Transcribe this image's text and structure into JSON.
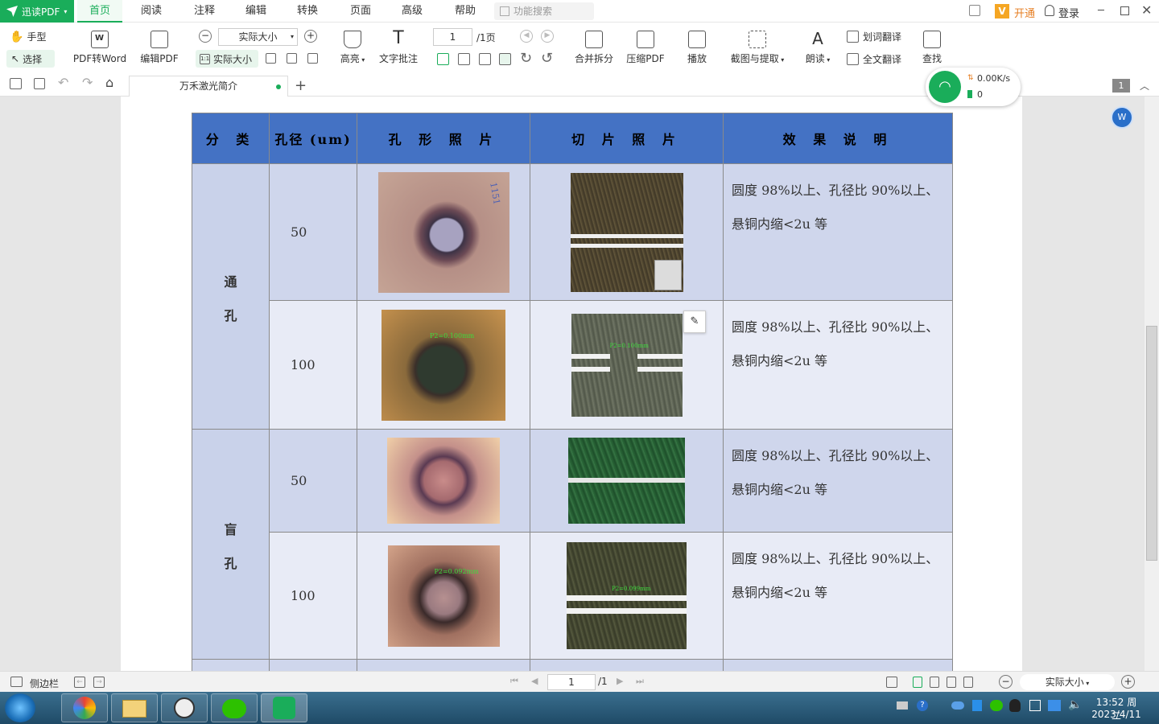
{
  "app": {
    "name": "迅读PDF"
  },
  "menu": {
    "items": [
      "首页",
      "阅读",
      "注释",
      "编辑",
      "转换",
      "页面",
      "高级",
      "帮助"
    ],
    "search_placeholder": "功能搜索",
    "open_vip": "开通",
    "login": "登录"
  },
  "toolbar": {
    "hand": "手型",
    "select": "选择",
    "pdf_to_word": "PDF转Word",
    "edit_pdf": "编辑PDF",
    "zoom_value": "实际大小",
    "actual_size": "实际大小",
    "page_input": "1",
    "page_total": "/1页",
    "highlight": "高亮",
    "text_comment": "文字批注",
    "merge_split": "合并拆分",
    "compress_pdf": "压缩PDF",
    "play": "播放",
    "screenshot": "截图与提取",
    "read_aloud": "朗读",
    "word_translate": "划词翻译",
    "full_translate": "全文翻译",
    "find": "查找"
  },
  "tabs": {
    "document": "万禾激光简介",
    "page_badge": "1"
  },
  "network": {
    "speed": "0.00K/s",
    "count": "0"
  },
  "table": {
    "headers": [
      "分 类",
      "孔径 (um)",
      "孔 形 照 片",
      "切 片 照 片",
      "效 果 说 明"
    ],
    "groups": [
      {
        "category": "通\n孔",
        "rows": [
          {
            "diameter": "50",
            "effect": "圆度 98%以上、孔径比 90%以上、悬铜内缩<2u 等",
            "overlay_hole": "1151",
            "overlay_slice": ""
          },
          {
            "diameter": "100",
            "effect": "圆度 98%以上、孔径比 90%以上、悬铜内缩<2u 等",
            "overlay_hole": "P2=0.100mm",
            "overlay_slice": "P2=0.100mm"
          }
        ]
      },
      {
        "category": "盲\n孔",
        "rows": [
          {
            "diameter": "50",
            "effect": "圆度 98%以上、孔径比 90%以上、悬铜内缩<2u 等",
            "overlay_hole": "",
            "overlay_slice": ""
          },
          {
            "diameter": "100",
            "effect": "圆度 98%以上、孔径比 90%以上、悬铜内缩<2u 等",
            "overlay_hole": "P2=0.092mm",
            "overlay_slice": "P2=0.099mm"
          }
        ]
      }
    ]
  },
  "status": {
    "sidebar": "侧边栏",
    "page_input": "1",
    "page_total": "/1",
    "zoom": "实际大小"
  },
  "taskbar": {
    "time": "13:52 周二",
    "date": "2023/4/11"
  },
  "colors": {
    "brand": "#1aad5a",
    "header_blue": "#4472c4",
    "row_dark": "#cfd6ec",
    "row_light": "#e8ebf6"
  }
}
